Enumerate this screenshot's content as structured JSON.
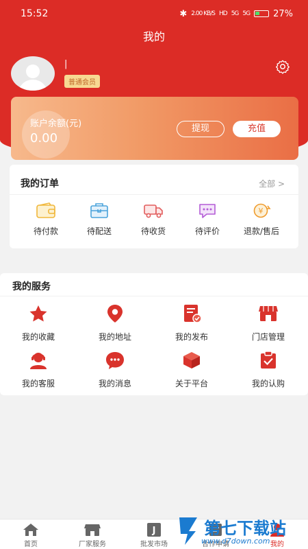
{
  "status_bar": {
    "time": "15:52",
    "speed": "2.00 KB/S",
    "hd": "HD",
    "signal1": "5G",
    "signal2": "5G",
    "battery": "27%"
  },
  "header": {
    "title": "我的"
  },
  "user": {
    "name": "|",
    "badge": "普通会员"
  },
  "balance": {
    "label": "账户余额(元)",
    "value": "0.00",
    "withdraw_label": "提现",
    "recharge_label": "充值"
  },
  "orders": {
    "title": "我的订单",
    "all_label": "全部 >",
    "items": [
      {
        "label": "待付款",
        "icon": "wallet-icon"
      },
      {
        "label": "待配送",
        "icon": "package-icon"
      },
      {
        "label": "待收货",
        "icon": "truck-icon"
      },
      {
        "label": "待评价",
        "icon": "comment-icon"
      },
      {
        "label": "退款/售后",
        "icon": "refund-icon"
      }
    ]
  },
  "services": {
    "title": "我的服务",
    "items": [
      {
        "label": "我的收藏",
        "icon": "star-icon"
      },
      {
        "label": "我的地址",
        "icon": "location-pin-icon"
      },
      {
        "label": "我的发布",
        "icon": "publish-icon"
      },
      {
        "label": "门店管理",
        "icon": "store-icon"
      },
      {
        "label": "我的客服",
        "icon": "customer-service-icon"
      },
      {
        "label": "我的消息",
        "icon": "message-icon"
      },
      {
        "label": "关于平台",
        "icon": "cube-icon"
      },
      {
        "label": "我的认购",
        "icon": "subscription-icon"
      }
    ]
  },
  "tabbar": {
    "items": [
      {
        "label": "首页",
        "icon": "home-icon"
      },
      {
        "label": "厂家服务",
        "icon": "factory-icon"
      },
      {
        "label": "批发市场",
        "icon": "wholesale-icon",
        "glyph": "J"
      },
      {
        "label": "合作申请",
        "icon": "cooperation-icon"
      },
      {
        "label": "我的",
        "icon": "profile-icon"
      }
    ]
  },
  "watermark": {
    "text": "第七下载站",
    "url": "www.d7down.com"
  },
  "colors": {
    "primary": "#dc2c26",
    "card_gradient_start": "#f7b98c",
    "card_gradient_end": "#ea6e45",
    "badge_bg": "#f7d992",
    "badge_text": "#c0692b"
  }
}
